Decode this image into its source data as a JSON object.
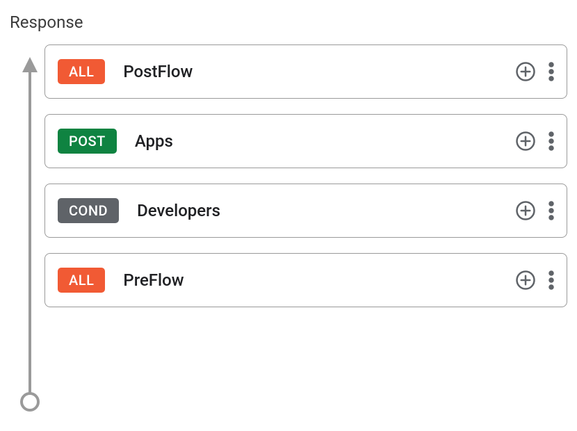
{
  "section_title": "Response",
  "badge_colors": {
    "ALL": "#f15a34",
    "POST": "#0f8341",
    "COND": "#5f6368"
  },
  "flows": [
    {
      "badge": "ALL",
      "name": "PostFlow"
    },
    {
      "badge": "POST",
      "name": "Apps"
    },
    {
      "badge": "COND",
      "name": "Developers"
    },
    {
      "badge": "ALL",
      "name": "PreFlow"
    }
  ]
}
